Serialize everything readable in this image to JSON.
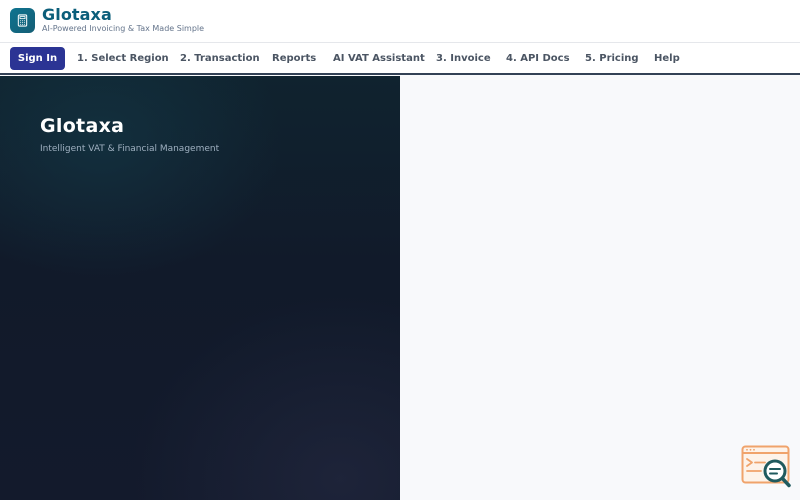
{
  "header": {
    "logo_icon": "calculator-icon",
    "title": "Glotaxa",
    "tagline": "AI-Powered Invoicing & Tax Made Simple"
  },
  "nav": {
    "signin_label": "Sign In",
    "items": [
      {
        "label": "1. Select Region"
      },
      {
        "label": "2. Transaction"
      },
      {
        "label": "Reports"
      },
      {
        "label": "AI VAT Assistant"
      },
      {
        "label": "3. Invoice"
      },
      {
        "label": "4. API Docs"
      },
      {
        "label": "5. Pricing"
      },
      {
        "label": "Help"
      }
    ]
  },
  "hero": {
    "title": "Glotaxa",
    "subtitle": "Intelligent VAT & Financial Management"
  },
  "widget": {
    "icon": "code-search-icon"
  },
  "colors": {
    "brand": "#0b5e7a",
    "signin_bg": "#2b3494",
    "hero_bg": "#111a2a",
    "widget_accent": "#f0a36b",
    "widget_lens": "#1f5a5e"
  }
}
